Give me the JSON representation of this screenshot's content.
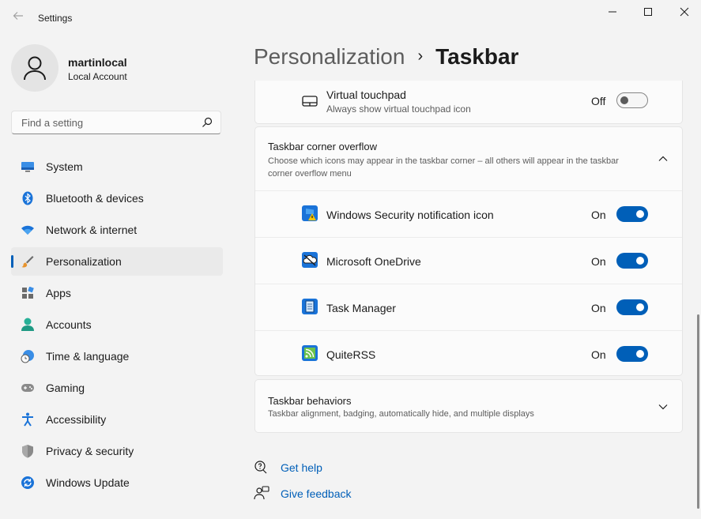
{
  "window": {
    "app_title": "Settings"
  },
  "profile": {
    "name": "martinlocal",
    "account_type": "Local Account"
  },
  "search": {
    "placeholder": "Find a setting"
  },
  "nav": {
    "items": [
      {
        "label": "System",
        "icon": "system-icon"
      },
      {
        "label": "Bluetooth & devices",
        "icon": "bluetooth-icon"
      },
      {
        "label": "Network & internet",
        "icon": "wifi-icon"
      },
      {
        "label": "Personalization",
        "icon": "brush-icon",
        "active": true
      },
      {
        "label": "Apps",
        "icon": "apps-icon"
      },
      {
        "label": "Accounts",
        "icon": "accounts-icon"
      },
      {
        "label": "Time & language",
        "icon": "clock-globe-icon"
      },
      {
        "label": "Gaming",
        "icon": "gamepad-icon"
      },
      {
        "label": "Accessibility",
        "icon": "accessibility-icon"
      },
      {
        "label": "Privacy & security",
        "icon": "shield-icon"
      },
      {
        "label": "Windows Update",
        "icon": "update-icon"
      }
    ]
  },
  "breadcrumb": {
    "parent": "Personalization",
    "separator": "›",
    "current": "Taskbar"
  },
  "virtual_touchpad": {
    "title": "Virtual touchpad",
    "subtitle": "Always show virtual touchpad icon",
    "state_label": "Off",
    "enabled": false
  },
  "corner_overflow": {
    "title": "Taskbar corner overflow",
    "description": "Choose which icons may appear in the taskbar corner – all others will appear in the taskbar corner overflow menu",
    "expanded": true,
    "items": [
      {
        "label": "Windows Security notification icon",
        "state_label": "On",
        "enabled": true,
        "icon": "windows-security-icon"
      },
      {
        "label": "Microsoft OneDrive",
        "state_label": "On",
        "enabled": true,
        "icon": "onedrive-icon"
      },
      {
        "label": "Task Manager",
        "state_label": "On",
        "enabled": true,
        "icon": "task-manager-icon"
      },
      {
        "label": "QuiteRSS",
        "state_label": "On",
        "enabled": true,
        "icon": "quiterss-icon"
      }
    ]
  },
  "behaviors": {
    "title": "Taskbar behaviors",
    "description": "Taskbar alignment, badging, automatically hide, and multiple displays"
  },
  "help": {
    "get_help": "Get help",
    "give_feedback": "Give feedback"
  },
  "colors": {
    "accent": "#005fb8",
    "background": "#f3f3f3",
    "card": "#fbfbfb"
  }
}
